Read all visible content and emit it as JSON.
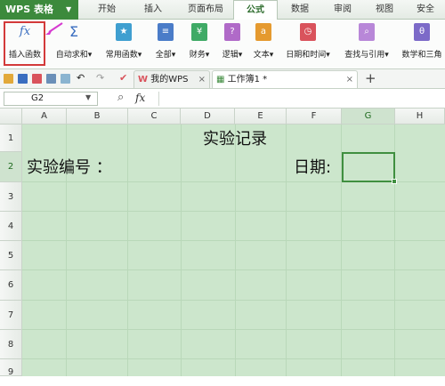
{
  "app": {
    "title": "WPS 表格"
  },
  "menu": {
    "tabs": [
      "开始",
      "插入",
      "页面布局",
      "公式",
      "数据",
      "审阅",
      "视图",
      "安全"
    ]
  },
  "ribbon": {
    "buttons": [
      {
        "icon": "function-fx-icon",
        "label": "插入函数"
      },
      {
        "icon": "sigma-icon",
        "label": "自动求和▾"
      },
      {
        "icon": "star-book-icon",
        "label": "常用函数▾"
      },
      {
        "icon": "book-icon",
        "label": "全部▾"
      },
      {
        "icon": "finance-book-icon",
        "label": "财务▾"
      },
      {
        "icon": "question-book-icon",
        "label": "逻辑▾"
      },
      {
        "icon": "text-book-icon",
        "label": "文本▾"
      },
      {
        "icon": "clock-book-icon",
        "label": "日期和时间▾"
      },
      {
        "icon": "search-book-icon",
        "label": "查找与引用▾"
      },
      {
        "icon": "math-book-icon",
        "label": "数学和三角"
      }
    ]
  },
  "toolbar": {
    "tabs": [
      {
        "label": "我的WPS"
      },
      {
        "label": "工作簿1 *"
      }
    ],
    "new_tab": "+",
    "close": "×"
  },
  "formula_bar": {
    "cell": "G2",
    "zoom_icon": "zoom-icon",
    "fx": "fx"
  },
  "columns": [
    "A",
    "B",
    "C",
    "D",
    "E",
    "F",
    "G",
    "H"
  ],
  "rows": [
    "1",
    "2",
    "3",
    "4",
    "5",
    "6",
    "7",
    "8",
    "9"
  ],
  "cells": {
    "title": "实验记录",
    "label_number": "实验编号 ：",
    "label_date": "日期:"
  },
  "colors": {
    "brand": "#3c8a3c",
    "grid": "#cce6cc",
    "selection": "#d33a3a"
  }
}
